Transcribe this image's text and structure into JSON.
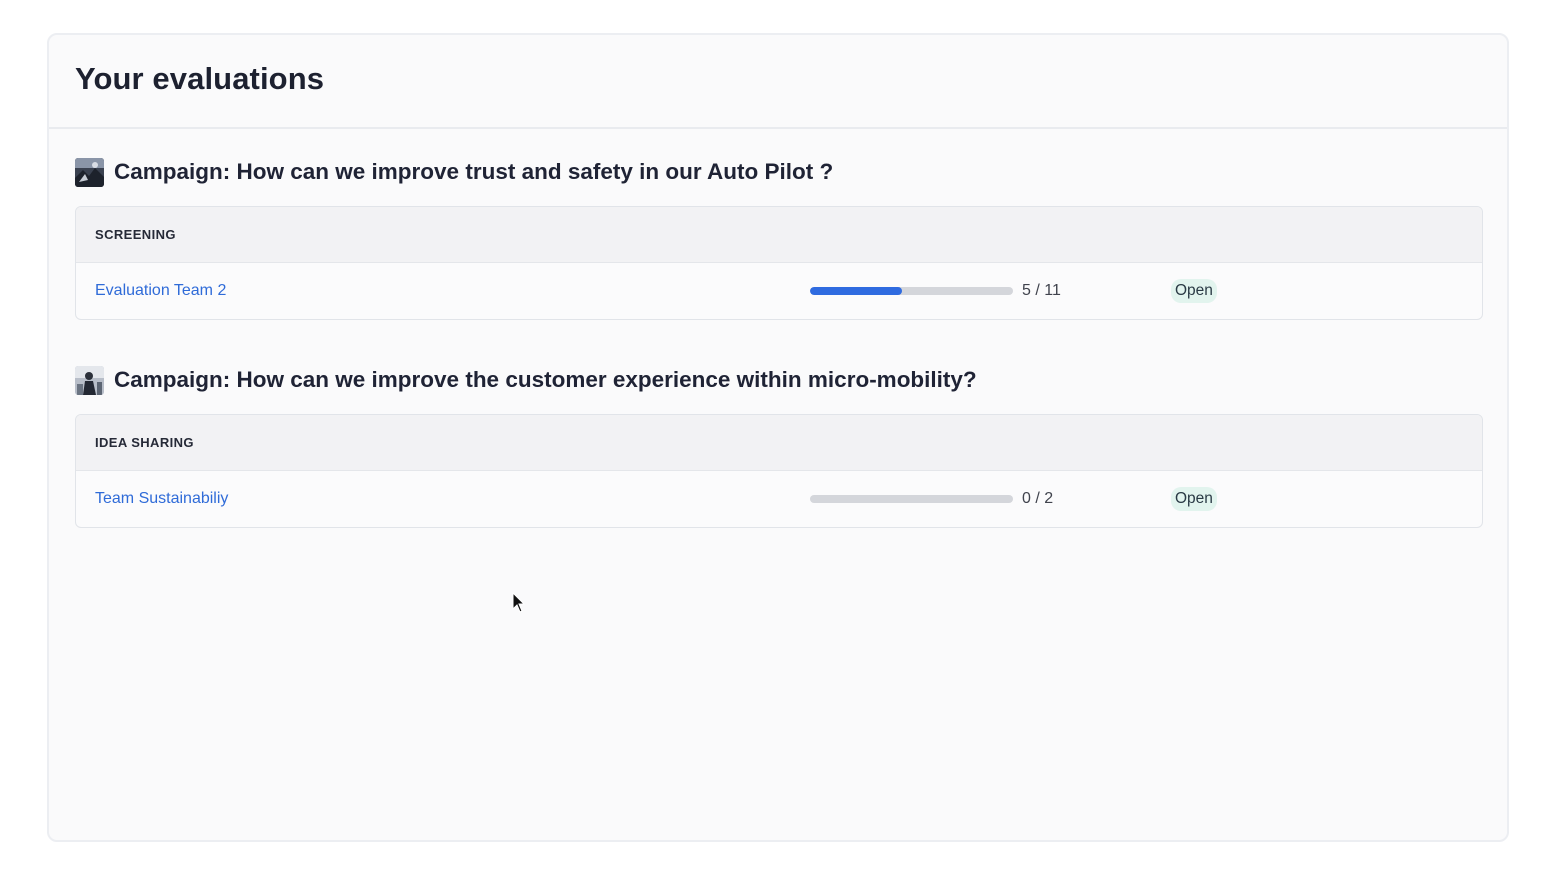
{
  "page": {
    "title": "Your evaluations"
  },
  "campaigns": [
    {
      "title": "Campaign: How can we improve trust and safety in our Auto Pilot ?",
      "thumb_icon": "campaign-image",
      "phase": "SCREENING",
      "rows": [
        {
          "team": "Evaluation Team 2",
          "progress_text": "5 / 11",
          "done": 5,
          "total": 11,
          "status": "Open"
        }
      ]
    },
    {
      "title": "Campaign: How can we improve the customer experience within micro-mobility?",
      "thumb_icon": "campaign-image",
      "phase": "IDEA SHARING",
      "rows": [
        {
          "team": "Team Sustainabiliy",
          "progress_text": "0 / 2",
          "done": 0,
          "total": 2,
          "status": "Open"
        }
      ]
    }
  ],
  "colors": {
    "accent": "#2f6be0",
    "link": "#2f6bd8",
    "badge_bg": "#e2f4ee"
  }
}
